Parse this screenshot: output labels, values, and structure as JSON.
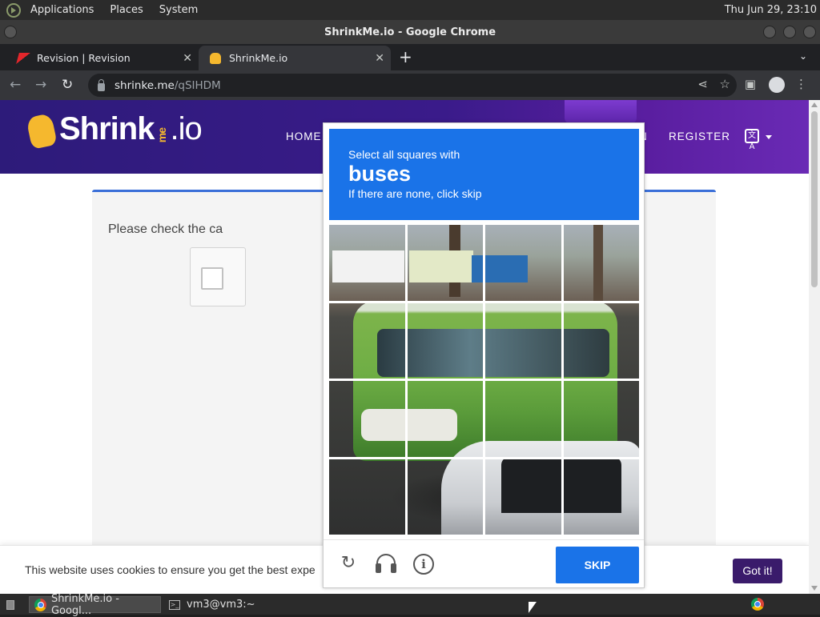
{
  "top_panel": {
    "menus": [
      "Applications",
      "Places",
      "System"
    ],
    "clock": "Thu Jun 29, 23:10"
  },
  "window": {
    "title": "ShrinkMe.io - Google Chrome"
  },
  "tabs": [
    {
      "label": "Revision | Revision",
      "active": false
    },
    {
      "label": "ShrinkMe.io",
      "active": true
    }
  ],
  "address_bar": {
    "host": "shrinke.me",
    "path": "/qSIHDM"
  },
  "site": {
    "logo_main": "Shrink",
    "logo_me": "me",
    "logo_io": ".io",
    "nav": {
      "home": "HOME",
      "login": "N",
      "register": "REGISTER"
    },
    "lang_icon": "文A"
  },
  "card": {
    "message": "Please check the ca"
  },
  "captcha": {
    "instruction": "Select all squares with",
    "target": "buses",
    "hint": "If there are none, click skip",
    "skip_label": "SKIP",
    "grid_size": 4
  },
  "cookie_bar": {
    "text": "This website uses cookies to ensure you get the best expe",
    "button": "Got it!"
  },
  "taskbar": {
    "chrome_task": "ShrinkMe.io - Googl...",
    "terminal_task": "vm3@vm3:~"
  },
  "colors": {
    "captcha_blue": "#1a73e8",
    "site_header": "#3a1b8a",
    "got_it_button": "#3a1b6b"
  }
}
